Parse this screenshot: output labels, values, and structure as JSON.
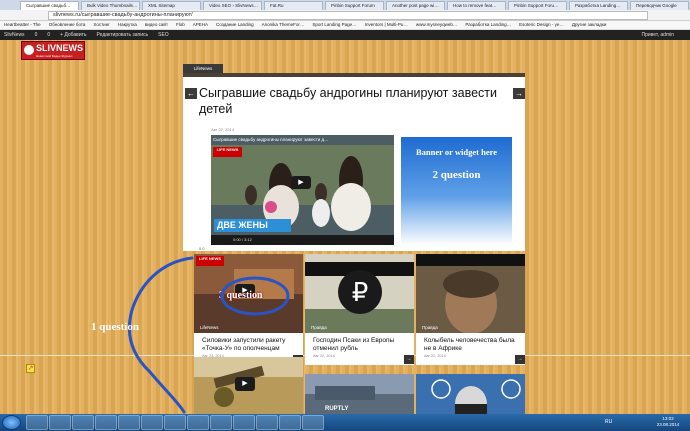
{
  "browser": {
    "tabs": [
      "Сыгравшие свадьб…",
      "Bulk Video Thumbnails…",
      "XML Sitemap",
      "Video SEO › SlivNews…",
      "Fat.Ru",
      "Pinbin Support Forum",
      "Another post page wi…",
      "How to remove feat…",
      "Pinbin Support Foru…",
      "Разработка Landing…",
      "Переводчик Google"
    ],
    "url": "slivnews.ru/сыгравшие-свадьбу-андрогины-планируют/",
    "bookmarks": [
      "Heartbeatter - The",
      "Обновление бота",
      "Хостинг",
      "Накрутка",
      "видео сайт",
      "Flob",
      "APEHA",
      "Создание Landing",
      "Anonikа ThemeFor…",
      "Sport Landing Page…",
      "Inventors | Multi-Pu…",
      "www.mysneyqweb…",
      "Разработка Landing…",
      "Esoteric Design - ye…",
      "Другие закладки"
    ]
  },
  "adminbar": {
    "items": [
      "SlivNews",
      "0",
      "0",
      "+ Добавить",
      "Редактировать запись",
      "SEO"
    ],
    "howdy": "Привет, admin"
  },
  "logo": {
    "title": "SLIVNEWS",
    "subtitle": "Новостной Видео Журнал"
  },
  "article": {
    "category": "LifeNews",
    "title": "Сыгравшие свадьбу андрогины планируют завести детей",
    "date": "Авг 22, 2014",
    "video_title": "Сыгравшие свадьбу андрогины планируют завести д…",
    "video_badge": "LIFE NEWS",
    "video_caption": "ДВЕ ЖЕНЫ",
    "video_time": "0:00 / 3:12",
    "counts": "0   0"
  },
  "banner": {
    "line1": "Banner or widget here",
    "line2": "2 question"
  },
  "annotation": {
    "label": "1 question"
  },
  "cards": [
    {
      "category": "LifeNews",
      "title": "Силовики запустили ракету «Точка-У» по ополченцам",
      "date": "Авг 23, 2014",
      "overlay": "3 question",
      "badge": "LIFE NEWS"
    },
    {
      "category": "Правда",
      "title": "Господин Псаки из Европы отменил рубль",
      "date": "Авг 22, 2014",
      "overlay": "",
      "badge": ""
    },
    {
      "category": "Правда",
      "title": "Колыбель человечества была не в Африке",
      "date": "Авг 22, 2014",
      "overlay": "",
      "badge": ""
    },
    {
      "category": "",
      "title": "",
      "date": "",
      "overlay": "",
      "badge": ""
    },
    {
      "category": "",
      "title": "",
      "date": "",
      "overlay": "",
      "badge": "RUPTLY"
    },
    {
      "category": "",
      "title": "",
      "date": "",
      "overlay": "",
      "badge": ""
    }
  ],
  "taskbar": {
    "time": "13:03",
    "date": "23.08.2014",
    "lang": "RU"
  }
}
